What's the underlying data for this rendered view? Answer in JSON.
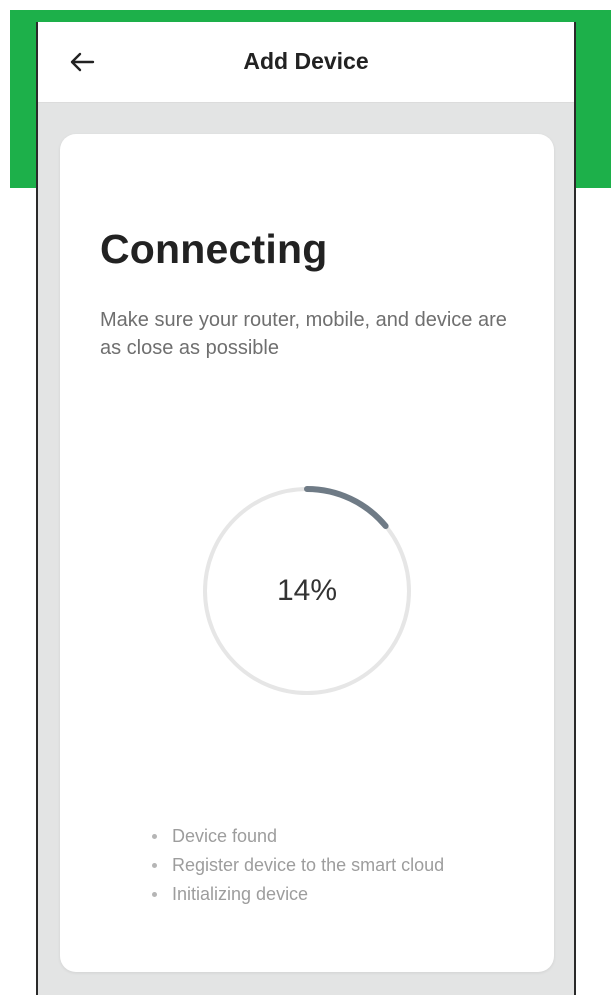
{
  "header": {
    "title": "Add Device",
    "back_icon": "arrow-left-icon"
  },
  "main": {
    "title": "Connecting",
    "description": "Make sure your router, mobile, and device are as close as possible",
    "progress": {
      "value": 14,
      "label": "14%"
    },
    "steps": [
      {
        "label": "Device found"
      },
      {
        "label": "Register device to the smart cloud"
      },
      {
        "label": "Initializing device"
      }
    ]
  },
  "colors": {
    "accent_green": "#1DB04A",
    "progress_track": "#E6E6E6",
    "progress_fill": "#6F7B86",
    "text_dark": "#222222",
    "text_muted": "#9D9D9D"
  }
}
